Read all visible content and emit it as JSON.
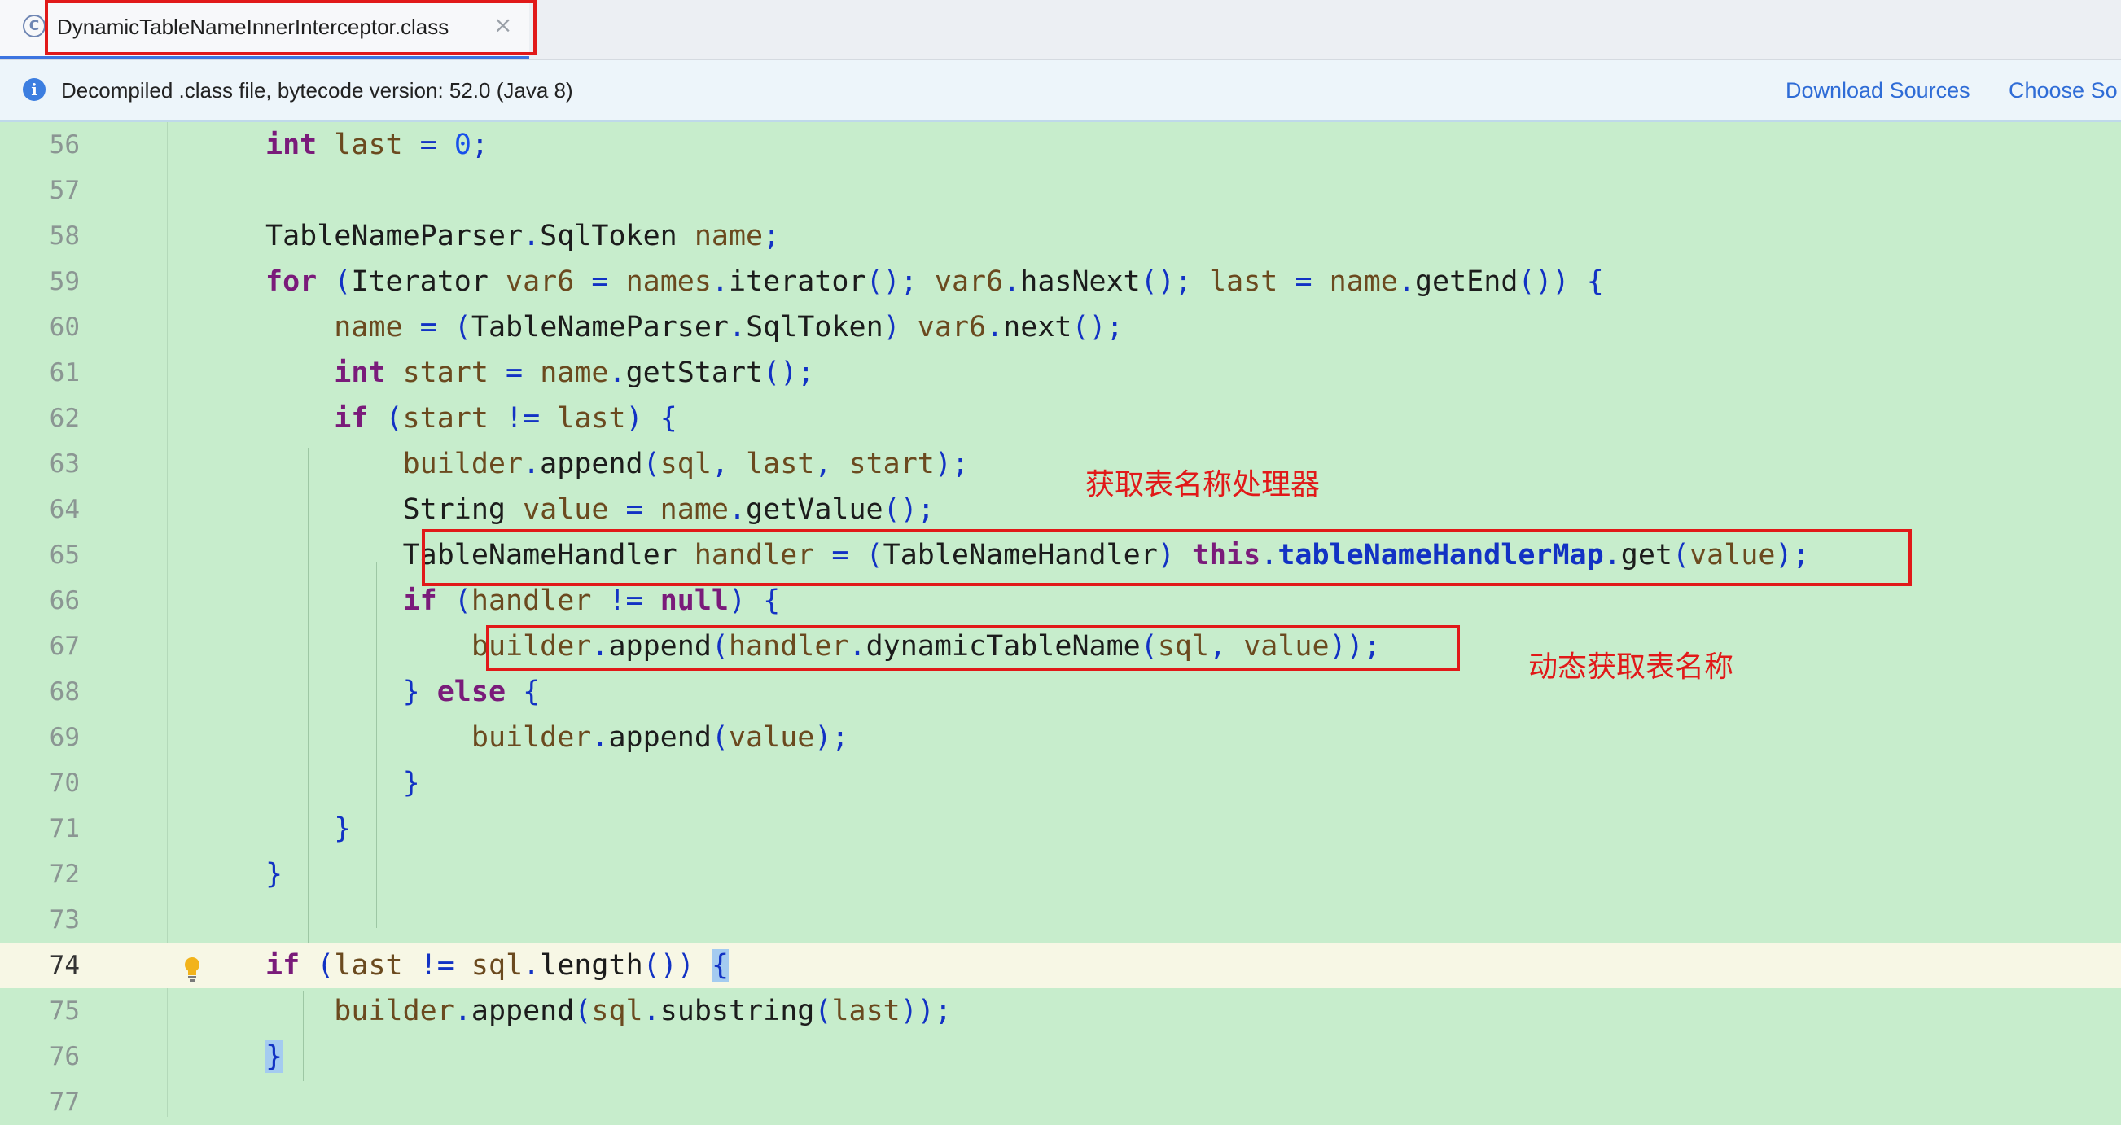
{
  "tab": {
    "icon_letter": "C",
    "icon": "class-icon",
    "title": "DynamicTableNameInnerInterceptor.class",
    "close": "×"
  },
  "banner": {
    "icon": "info-icon",
    "text": "Decompiled .class file, bytecode version: 52.0 (Java 8)",
    "download_sources": "Download Sources",
    "choose_sources": "Choose So"
  },
  "code_lines": [
    {
      "num": "56"
    },
    {
      "num": "57"
    },
    {
      "num": "58"
    },
    {
      "num": "59"
    },
    {
      "num": "60"
    },
    {
      "num": "61"
    },
    {
      "num": "62"
    },
    {
      "num": "63"
    },
    {
      "num": "64"
    },
    {
      "num": "65"
    },
    {
      "num": "66"
    },
    {
      "num": "67"
    },
    {
      "num": "68"
    },
    {
      "num": "69"
    },
    {
      "num": "70"
    },
    {
      "num": "71"
    },
    {
      "num": "72"
    },
    {
      "num": "73"
    },
    {
      "num": "74"
    },
    {
      "num": "75"
    },
    {
      "num": "76"
    },
    {
      "num": "77"
    }
  ],
  "annotations": {
    "handler_label": "获取表名称处理器",
    "dynamic_label": "动态获取表名称"
  },
  "colors": {
    "editor_bg": "#c7edcc",
    "current_line_bg": "#f7f7e5",
    "annotation_red": "#e11919",
    "link_blue": "#2f6cd6",
    "tab_underline": "#3d74e0"
  }
}
